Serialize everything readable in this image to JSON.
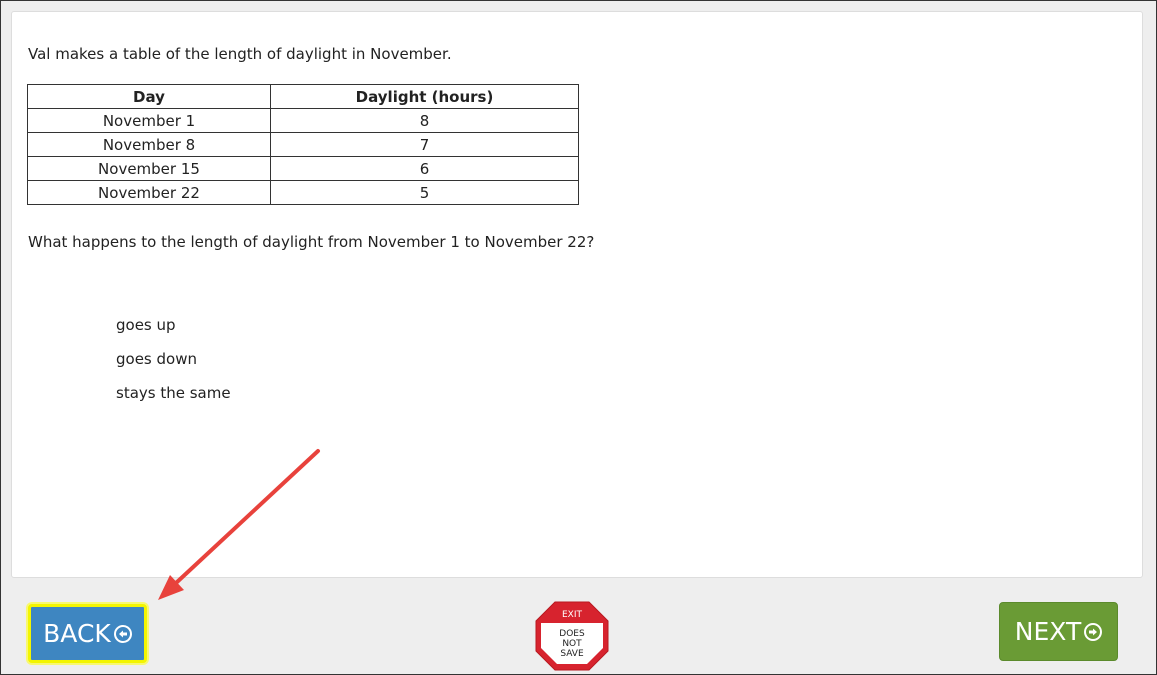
{
  "question": {
    "intro": "Val makes a table of the length of daylight in November.",
    "table": {
      "headers": [
        "Day",
        "Daylight (hours)"
      ],
      "rows": [
        [
          "November 1",
          "8"
        ],
        [
          "November 8",
          "7"
        ],
        [
          "November 15",
          "6"
        ],
        [
          "November 22",
          "5"
        ]
      ]
    },
    "prompt": "What happens to the length of daylight from November 1 to November 22?",
    "choices": [
      "goes up",
      "goes down",
      "stays the same"
    ]
  },
  "nav": {
    "back_label": "BACK",
    "next_label": "NEXT",
    "exit": {
      "top": "EXIT",
      "line1": "DOES",
      "line2": "NOT",
      "line3": "SAVE"
    }
  },
  "colors": {
    "back_button": "#3e86c1",
    "next_button": "#6a9b35",
    "exit_red": "#d7232e",
    "highlight": "#f3f500",
    "annotation_arrow": "#e8423c"
  },
  "icons": {
    "back": "arrow-left-circle-icon",
    "next": "arrow-right-circle-icon",
    "exit": "exit-stop-sign-icon",
    "annotation": "red-pointer-arrow"
  }
}
